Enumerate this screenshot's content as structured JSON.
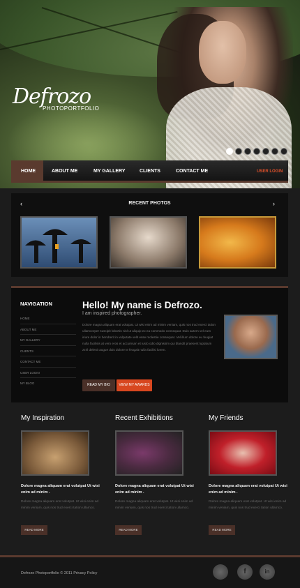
{
  "brand": {
    "name": "Defrozo",
    "subtitle": "PHOTOPORTFOLIO"
  },
  "slider": {
    "dots": 7,
    "active_index": 0
  },
  "nav": {
    "items": [
      "HOME",
      "ABOUT ME",
      "MY GALLERY",
      "CLIENTS",
      "CONTACT ME"
    ],
    "active": "HOME",
    "user_login": "USER LOGIN"
  },
  "recent_photos": {
    "title": "RECENT PHOTOS",
    "prev": "‹",
    "next": "›"
  },
  "sidebar": {
    "title": "NAVIGATION",
    "items": [
      "HOME",
      "ABOUT ME",
      "MY GALLERY",
      "CLIENTS",
      "CONTACT ME",
      "USER LOGIN",
      "MY BLOG"
    ]
  },
  "about": {
    "heading": "Hello! My name is Defrozo.",
    "subheading": "I am inspired photographer.",
    "text": "Dolore magna aliquam erat volutpat. Ut wisi enim ad minim veniam, quis nos trud exerci tation ullamcorper suscipit lobortis nisl ut aliquip ex ea commodo consequat. Duis autem vel eum iriure dolor in hendrerit in vulputate velit esse molestie consequat. Vel illum dolore eu feugiat nulla facilisis at vero eros et accumsan et iusto odio dignissim qui blandit praesent luptatum zzril delenit augue duis dolore te feugait nulla facilisi lorem.",
    "btn_bio": "READ MY BIO",
    "btn_awards": "VIEW MY AWARDS"
  },
  "columns": [
    {
      "title": "My Inspiration",
      "bold": "Dolore magna aliquam erat volutpat Ut wisi enim ad minim .",
      "text": "Dolore magna aliquam erat volutpat. Ut wisi enim ad minim veniam, quis nos trud exerci tation ullamco.",
      "button": "READ MORE"
    },
    {
      "title": "Recent Exhibitions",
      "bold": "Dolore magna aliquam erat volutpat Ut wisi enim ad minim .",
      "text": "Dolore magna aliquam erat volutpat. Ut wisi enim ad minim veniam, quis nos trud exerci tation ullamco.",
      "button": "READ MORE"
    },
    {
      "title": "My Friends",
      "bold": "Dolore magna aliquam erat volutpat Ut wisi enim ad minim .",
      "text": "Dolore magna aliquam erat volutpat. Ut wisi enim ad minim veniam, quis nos trud exerci tation ullamco.",
      "button": "READ MORE"
    }
  ],
  "footer": {
    "copyright": "Defrozo Photoportfolio © 2011 Privacy Policy"
  },
  "social": [
    {
      "icon": "delicious-icon",
      "glyph": ""
    },
    {
      "icon": "facebook-icon",
      "glyph": "f"
    },
    {
      "icon": "linkedin-icon",
      "glyph": "in"
    }
  ],
  "colors": {
    "accent": "#d8471f",
    "brown": "#5a3a2e",
    "bg": "#1c1c1c"
  }
}
